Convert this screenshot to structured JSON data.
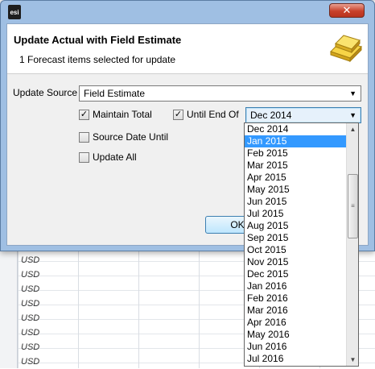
{
  "dialog": {
    "title": "Update Actual with Field Estimate",
    "subtitle": "1 Forecast items selected for update",
    "app_icon_text": "esi",
    "close_label": "✕",
    "ok_label": "OK"
  },
  "update_source": {
    "label": "Update Source",
    "value": "Field Estimate"
  },
  "maintain_total": {
    "label": "Maintain Total",
    "checked": true
  },
  "until_end_of": {
    "label": "Until End Of",
    "checked": true,
    "value": "Dec 2014"
  },
  "source_date_until": {
    "label": "Source Date Until",
    "checked": false
  },
  "update_all": {
    "label": "Update All",
    "checked": false
  },
  "dropdown": {
    "selected": "Jan 2015",
    "items": [
      "Dec 2014",
      "Jan 2015",
      "Feb 2015",
      "Mar 2015",
      "Apr 2015",
      "May 2015",
      "Jun 2015",
      "Jul 2015",
      "Aug 2015",
      "Sep 2015",
      "Oct 2015",
      "Nov 2015",
      "Dec 2015",
      "Jan 2016",
      "Feb 2016",
      "Mar 2016",
      "Apr 2016",
      "May 2016",
      "Jun 2016",
      "Jul 2016"
    ]
  },
  "background": {
    "currency_cells": [
      "USD",
      "USD",
      "USD",
      "USD",
      "USD",
      "USD",
      "USD",
      "USD"
    ]
  },
  "icons": {
    "app": "esi-app-icon",
    "gold": "gold-bar-icon",
    "check": "✓",
    "dropdown_arrow": "▼",
    "scroll_up": "▲",
    "scroll_down": "▼",
    "grip": "≡"
  },
  "colors": {
    "titlebar": "#9fbfe3",
    "selection": "#3399ff",
    "close_button": "#c8412a"
  }
}
